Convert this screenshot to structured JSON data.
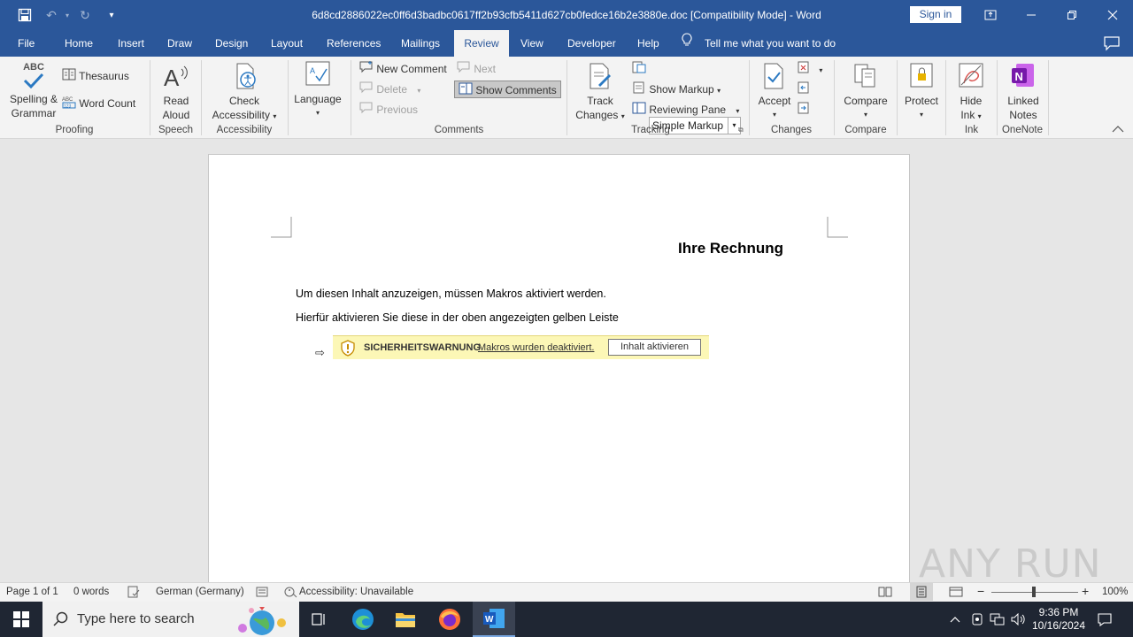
{
  "titlebar": {
    "title": "6d8cd2886022ec0ff6d3badbc0617ff2b93cfb5411d627cb0fedce16b2e3880e.doc [Compatibility Mode]  -  Word",
    "sign_in": "Sign in"
  },
  "tabs": [
    "File",
    "Home",
    "Insert",
    "Draw",
    "Design",
    "Layout",
    "References",
    "Mailings",
    "Review",
    "View",
    "Developer",
    "Help"
  ],
  "active_tab": "Review",
  "tell_me": "Tell me what you want to do",
  "ribbon": {
    "proofing": {
      "spelling": "Spelling &",
      "grammar": "Grammar",
      "spelling_icon_text": "ABC",
      "thesaurus": "Thesaurus",
      "word_count": "Word Count",
      "label": "Proofing"
    },
    "speech": {
      "read": "Read",
      "aloud": "Aloud",
      "label": "Speech"
    },
    "accessibility": {
      "check": "Check",
      "accessibility": "Accessibility",
      "label": "Accessibility"
    },
    "language": {
      "button": "Language"
    },
    "comments": {
      "new": "New Comment",
      "delete": "Delete",
      "previous": "Previous",
      "next": "Next",
      "show": "Show Comments",
      "label": "Comments"
    },
    "tracking": {
      "track": "Track",
      "changes": "Changes",
      "markup": "Simple Markup",
      "show_markup": "Show Markup",
      "reviewing_pane": "Reviewing Pane",
      "label": "Tracking"
    },
    "changes": {
      "accept": "Accept",
      "label": "Changes"
    },
    "compare": {
      "compare": "Compare",
      "label": "Compare"
    },
    "protect": {
      "protect": "Protect"
    },
    "ink": {
      "hide": "Hide",
      "ink": "Ink",
      "label": "Ink"
    },
    "onenote": {
      "linked": "Linked",
      "notes": "Notes",
      "label": "OneNote",
      "logo_letter": "N"
    }
  },
  "document": {
    "title": "Ihre Rechnung",
    "line1": "Um diesen Inhalt anzuzeigen, müssen Makros aktiviert werden.",
    "line2": "Hierfür aktivieren Sie diese in der oben angezeigten gelben Leiste",
    "warning_title": "SICHERHEITSWARNUNG",
    "warning_link": "Makros wurden deaktiviert.",
    "warning_button": "Inhalt aktivieren",
    "arrow": "⇨"
  },
  "watermark": "ANY RUN",
  "statusbar": {
    "page": "Page 1 of 1",
    "words": "0 words",
    "language": "German (Germany)",
    "accessibility": "Accessibility: Unavailable",
    "zoom": "100%",
    "zoom_level": 1.0
  },
  "taskbar": {
    "search_placeholder": "Type here to search",
    "time": "9:36 PM",
    "date": "10/16/2024"
  },
  "colors": {
    "word_blue": "#2b579a",
    "warning_yellow": "#fcf7b6",
    "taskbar": "#1f2633"
  }
}
